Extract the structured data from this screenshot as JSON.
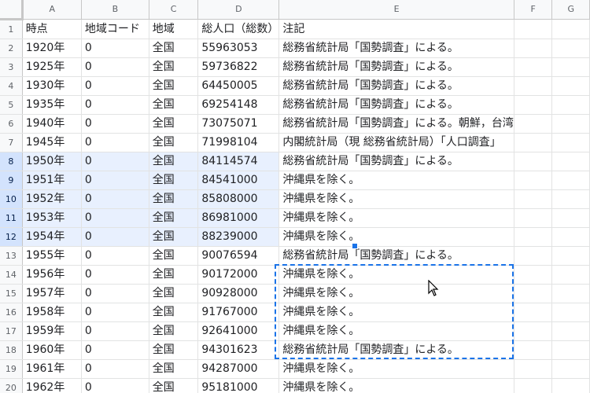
{
  "columns": [
    "A",
    "B",
    "C",
    "D",
    "E",
    "F",
    "G"
  ],
  "rows": [
    {
      "num": "1",
      "a": "時点",
      "b": "地域コード",
      "c": "地域",
      "d": "総人口（総数）",
      "e": "注記"
    },
    {
      "num": "2",
      "a": "1920年",
      "b": "0",
      "c": "全国",
      "d": "55963053",
      "e": "総務省統計局「国勢調査」による。"
    },
    {
      "num": "3",
      "a": "1925年",
      "b": "0",
      "c": "全国",
      "d": "59736822",
      "e": "総務省統計局「国勢調査」による。"
    },
    {
      "num": "4",
      "a": "1930年",
      "b": "0",
      "c": "全国",
      "d": "64450005",
      "e": "総務省統計局「国勢調査」による。"
    },
    {
      "num": "5",
      "a": "1935年",
      "b": "0",
      "c": "全国",
      "d": "69254148",
      "e": "総務省統計局「国勢調査」による。"
    },
    {
      "num": "6",
      "a": "1940年",
      "b": "0",
      "c": "全国",
      "d": "73075071",
      "e": "総務省統計局「国勢調査」による。朝鮮，台湾"
    },
    {
      "num": "7",
      "a": "1945年",
      "b": "0",
      "c": "全国",
      "d": "71998104",
      "e": "内閣統計局（現 総務省統計局）「人口調査」"
    },
    {
      "num": "8",
      "a": "1950年",
      "b": "0",
      "c": "全国",
      "d": "84114574",
      "e": "総務省統計局「国勢調査」による。"
    },
    {
      "num": "9",
      "a": "1951年",
      "b": "0",
      "c": "全国",
      "d": "84541000",
      "e": "沖縄県を除く。"
    },
    {
      "num": "10",
      "a": "1952年",
      "b": "0",
      "c": "全国",
      "d": "85808000",
      "e": "沖縄県を除く。"
    },
    {
      "num": "11",
      "a": "1953年",
      "b": "0",
      "c": "全国",
      "d": "86981000",
      "e": "沖縄県を除く。"
    },
    {
      "num": "12",
      "a": "1954年",
      "b": "0",
      "c": "全国",
      "d": "88239000",
      "e": "沖縄県を除く。"
    },
    {
      "num": "13",
      "a": "1955年",
      "b": "0",
      "c": "全国",
      "d": "90076594",
      "e": "総務省統計局「国勢調査」による。"
    },
    {
      "num": "14",
      "a": "1956年",
      "b": "0",
      "c": "全国",
      "d": "90172000",
      "e": "沖縄県を除く。"
    },
    {
      "num": "15",
      "a": "1957年",
      "b": "0",
      "c": "全国",
      "d": "90928000",
      "e": "沖縄県を除く。"
    },
    {
      "num": "16",
      "a": "1958年",
      "b": "0",
      "c": "全国",
      "d": "91767000",
      "e": "沖縄県を除く。"
    },
    {
      "num": "17",
      "a": "1959年",
      "b": "0",
      "c": "全国",
      "d": "92641000",
      "e": "沖縄県を除く。"
    },
    {
      "num": "18",
      "a": "1960年",
      "b": "0",
      "c": "全国",
      "d": "94301623",
      "e": "総務省統計局「国勢調査」による。"
    },
    {
      "num": "19",
      "a": "1961年",
      "b": "0",
      "c": "全国",
      "d": "94287000",
      "e": "沖縄県を除く。"
    },
    {
      "num": "20",
      "a": "1962年",
      "b": "0",
      "c": "全国",
      "d": "95181000",
      "e": "沖縄県を除く。"
    }
  ],
  "selection": {
    "color": "#1a73e8",
    "fill": "#e8f0fe"
  }
}
